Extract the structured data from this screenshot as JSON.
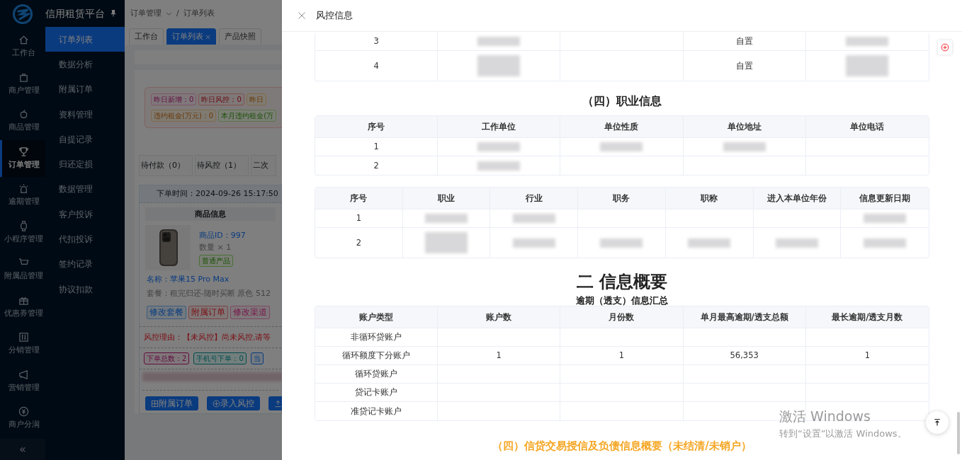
{
  "app": {
    "brand": "信用租赁平台",
    "nav": [
      {
        "label": "工作台",
        "selected": false
      },
      {
        "label": "商户管理",
        "selected": false
      },
      {
        "label": "商品管理",
        "selected": false
      },
      {
        "label": "订单管理",
        "selected": true
      },
      {
        "label": "逾期管理",
        "selected": false
      },
      {
        "label": "小程序管理",
        "selected": false
      },
      {
        "label": "附属品管理",
        "selected": false
      },
      {
        "label": "优惠券管理",
        "selected": false
      },
      {
        "label": "分销管理",
        "selected": false
      },
      {
        "label": "营销管理",
        "selected": false
      },
      {
        "label": "商户分润",
        "selected": false
      }
    ],
    "collapse": "«",
    "submenu": [
      {
        "label": "订单列表",
        "selected": true
      },
      {
        "label": "数据分析",
        "selected": false
      },
      {
        "label": "附属订单",
        "selected": false
      },
      {
        "label": "资料管理",
        "selected": false
      },
      {
        "label": "自提记录",
        "selected": false
      },
      {
        "label": "归还定损",
        "selected": false
      },
      {
        "label": "数据管理",
        "selected": false
      },
      {
        "label": "客户投诉",
        "selected": false
      },
      {
        "label": "代扣投诉",
        "selected": false
      },
      {
        "label": "签约记录",
        "selected": false
      },
      {
        "label": "协议扣款",
        "selected": false
      }
    ],
    "breadcrumb": [
      "订单管理",
      "订单列表"
    ],
    "breadcrumb_separator": "/",
    "tabs": [
      {
        "label": "工作台",
        "selected": false,
        "closable": false
      },
      {
        "label": "订单列表",
        "selected": true,
        "closable": true
      },
      {
        "label": "产品快照",
        "selected": false,
        "closable": false
      }
    ],
    "stats": [
      [
        "昨日新增：0",
        "昨日风控：0",
        "昨日"
      ],
      [
        "违约租金(万元)：0",
        "本月违约租金(万"
      ]
    ],
    "status_tabs": [
      "待付款（0）",
      "待风控（1）",
      "二次"
    ],
    "order": {
      "time": "下单时间：2024-09-26 15:17:50",
      "goods_header": "商品信息",
      "goods_id": "商品ID：997",
      "quantity": "数量 × 1",
      "tag": "普通产品",
      "name_label": "名称：",
      "name": "苹果15 Pro Max",
      "package": "套餐：租完归还-随时买断 原色 512",
      "actions": [
        "修改套餐",
        "附属订单",
        "修改渠道"
      ],
      "risk_label": "风控理由：",
      "risk_text": "【未风控】尚未风控,请等",
      "counts": [
        "下单总数：2",
        "手机号下单：0",
        "当"
      ],
      "buttons": [
        "附属订单",
        "录入风控"
      ]
    }
  },
  "drawer": {
    "title": "风控信息",
    "sections": [
      {
        "kind": "table",
        "rows": [
          [
            "3",
            {
              "kind": "blurred"
            },
            "",
            "自置",
            {
              "kind": "blurred"
            }
          ],
          [
            "4",
            {
              "kind": "blurred-tall"
            },
            "",
            "自置",
            {
              "kind": "blurred-tall"
            }
          ]
        ]
      },
      {
        "kind": "heading",
        "text": "（四）职业信息"
      },
      {
        "kind": "table",
        "columns": [
          "序号",
          "工作单位",
          "单位性质",
          "单位地址",
          "单位电话"
        ],
        "rows": [
          [
            "1",
            {
              "kind": "blurred"
            },
            {
              "kind": "blurred"
            },
            {
              "kind": "blurred"
            },
            ""
          ],
          [
            "2",
            {
              "kind": "blurred"
            },
            "",
            "",
            ""
          ]
        ]
      },
      {
        "kind": "table",
        "columns": [
          "序号",
          "职业",
          "行业",
          "职务",
          "职称",
          "进入本单位年份",
          "信息更新日期"
        ],
        "rows": [
          [
            "1",
            {
              "kind": "blurred"
            },
            {
              "kind": "blurred"
            },
            "",
            "",
            "",
            {
              "kind": "blurred"
            }
          ],
          [
            "2",
            {
              "kind": "blurred-tall"
            },
            {
              "kind": "blurred"
            },
            {
              "kind": "blurred"
            },
            {
              "kind": "blurred"
            },
            {
              "kind": "blurred"
            },
            {
              "kind": "blurred"
            }
          ]
        ]
      },
      {
        "kind": "title",
        "text": "二 信息概要"
      },
      {
        "kind": "subtitle",
        "text": "逾期（透支）信息汇总"
      },
      {
        "kind": "table",
        "columns": [
          "账户类型",
          "账户数",
          "月份数",
          "单月最高逾期/透支总额",
          "最长逾期/透支月数"
        ],
        "rows": [
          [
            "非循环贷账户",
            "",
            "",
            "",
            ""
          ],
          [
            "循环额度下分账户",
            "1",
            "1",
            "56,353",
            "1"
          ],
          [
            "循环贷账户",
            "",
            "",
            "",
            ""
          ],
          [
            "贷记卡账户",
            "",
            "",
            "",
            ""
          ],
          [
            "准贷记卡账户",
            "",
            "",
            "",
            ""
          ]
        ]
      },
      {
        "kind": "accent",
        "text": "（四）信贷交易授信及负债信息概要（未结清/未销户）"
      }
    ]
  },
  "os_notice": {
    "title": "激活 Windows",
    "text": "转到“设置”以激活 Windows。"
  }
}
